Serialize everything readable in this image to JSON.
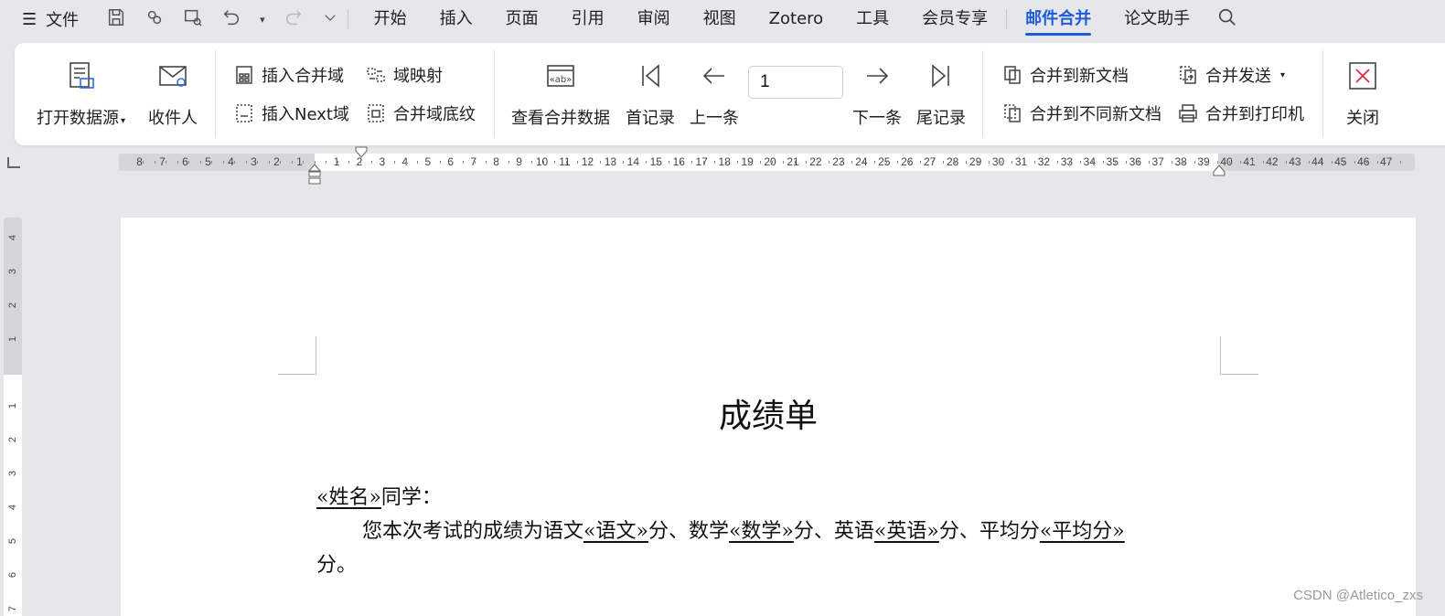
{
  "menubar": {
    "file_label": "文件",
    "tabs": [
      "开始",
      "插入",
      "页面",
      "引用",
      "审阅",
      "视图",
      "Zotero",
      "工具",
      "会员专享",
      "邮件合并",
      "论文助手"
    ],
    "active_tab": "邮件合并"
  },
  "ribbon": {
    "open_datasource": "打开数据源",
    "recipients": "收件人",
    "insert_merge_field": "插入合并域",
    "field_mapping": "域映射",
    "insert_next_field": "插入Next域",
    "merge_field_shading": "合并域底纹",
    "view_merged_data": "查看合并数据",
    "first_record": "首记录",
    "prev_record": "上一条",
    "record_number": "1",
    "next_record": "下一条",
    "last_record": "尾记录",
    "merge_to_new_doc": "合并到新文档",
    "merge_send": "合并发送",
    "merge_to_separate_docs": "合并到不同新文档",
    "merge_to_printer": "合并到打印机",
    "close": "关闭"
  },
  "ruler": {
    "left_numbers": [
      "8",
      "7",
      "6",
      "5",
      "4",
      "3",
      "2",
      "1"
    ],
    "right_numbers": [
      "1",
      "2",
      "3",
      "4",
      "5",
      "6",
      "7",
      "8",
      "9",
      "10",
      "11",
      "12",
      "13",
      "14",
      "15",
      "16",
      "17",
      "18",
      "19",
      "20",
      "21",
      "22",
      "23",
      "24",
      "25",
      "26",
      "27",
      "28",
      "29",
      "30",
      "31",
      "32",
      "33",
      "34",
      "35",
      "36",
      "37",
      "38",
      "39",
      "40",
      "41",
      "42",
      "43",
      "44",
      "45",
      "46",
      "47"
    ],
    "vertical_top": [
      "4",
      "3",
      "2",
      "1"
    ],
    "vertical_bottom": [
      "1",
      "2",
      "3",
      "4",
      "5",
      "6",
      "7"
    ]
  },
  "document": {
    "title": "成绩单",
    "salutation_field": "«姓名»",
    "salutation_text": "同学：",
    "line2_p1": "您本次考试的成绩为语文",
    "field_chinese": "«语文»",
    "line2_p2": "分、数学",
    "field_math": "«数学»",
    "line2_p3": "分、英语",
    "field_english": "«英语»",
    "line2_p4": "分、平均分",
    "field_average": "«平均分»",
    "line3": "分。"
  },
  "watermark": "CSDN @Atletico_zxs",
  "colors": {
    "accent": "#1f5bd8",
    "close_icon": "#d9263a",
    "doc_field_blue": "#2a6fdb"
  }
}
